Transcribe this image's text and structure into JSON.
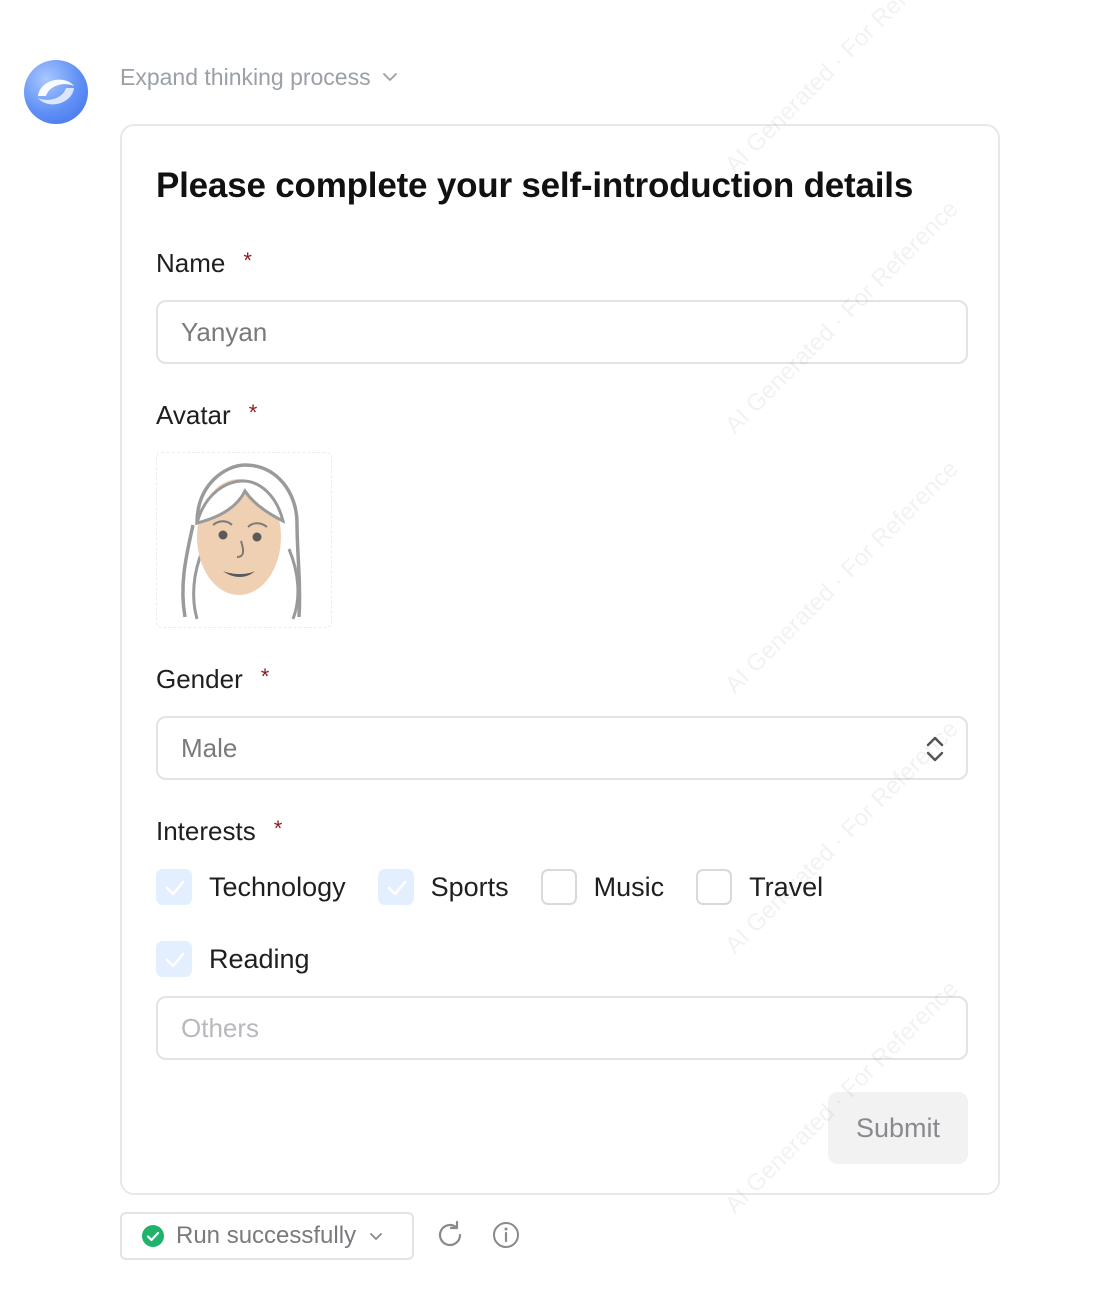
{
  "header": {
    "expand_label": "Expand thinking process"
  },
  "form": {
    "title": "Please complete your self-introduction details",
    "required_mark": "*",
    "name": {
      "label": "Name",
      "value": "Yanyan"
    },
    "avatar": {
      "label": "Avatar"
    },
    "gender": {
      "label": "Gender",
      "value": "Male"
    },
    "interests": {
      "label": "Interests",
      "options": [
        {
          "label": "Technology",
          "checked": true
        },
        {
          "label": "Sports",
          "checked": true
        },
        {
          "label": "Music",
          "checked": false
        },
        {
          "label": "Travel",
          "checked": false
        },
        {
          "label": "Reading",
          "checked": true
        }
      ],
      "others_placeholder": "Others"
    },
    "submit_label": "Submit"
  },
  "footer": {
    "status_label": "Run successfully",
    "status_color": "#1fb36b"
  },
  "watermark": "AI Generated · For Reference",
  "colors": {
    "accent_checkbox": "#e3eeff",
    "required": "#8b1a1a"
  }
}
